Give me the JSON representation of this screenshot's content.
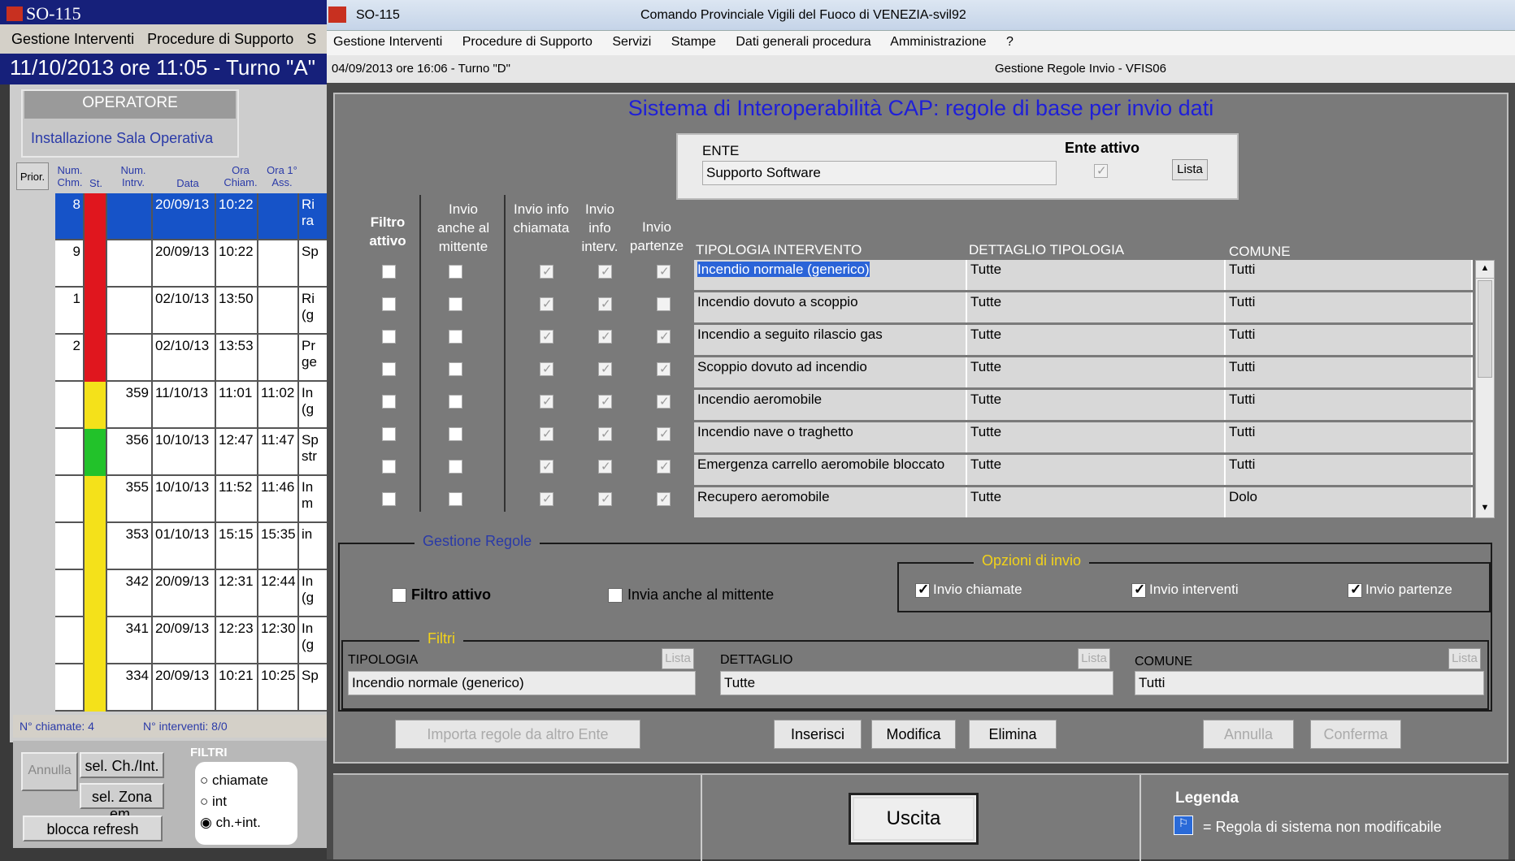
{
  "bg_window": {
    "title": "SO-115",
    "menu": [
      "Gestione Interventi",
      "Procedure di Supporto",
      "S"
    ],
    "datetime": "11/10/2013 ore 11:05 - Turno \"A\"",
    "operator_header": "OPERATORE",
    "operator_sub": "Installazione Sala Operativa",
    "prior_button": "Prior.",
    "columns": [
      "Num. Chm.",
      "St.",
      "Num. Intrv.",
      "Data",
      "Ora Chiam.",
      "Ora 1° Ass."
    ],
    "rows": [
      {
        "num_chm": "8",
        "status": "#e0161e",
        "num_intrv": "",
        "data": "20/09/13",
        "ora_chiam": "10:22",
        "ora_ass": "",
        "desc": "Ri ra",
        "selected": true
      },
      {
        "num_chm": "9",
        "status": "#e0161e",
        "num_intrv": "",
        "data": "20/09/13",
        "ora_chiam": "10:22",
        "ora_ass": "",
        "desc": "Sp"
      },
      {
        "num_chm": "1",
        "status": "#e0161e",
        "num_intrv": "",
        "data": "02/10/13",
        "ora_chiam": "13:50",
        "ora_ass": "",
        "desc": "Ri (g"
      },
      {
        "num_chm": "2",
        "status": "#e0161e",
        "num_intrv": "",
        "data": "02/10/13",
        "ora_chiam": "13:53",
        "ora_ass": "",
        "desc": "Pr ge"
      },
      {
        "num_chm": "",
        "status": "#f4e11a",
        "num_intrv": "359",
        "data": "11/10/13",
        "ora_chiam": "11:01",
        "ora_ass": "11:02",
        "desc": "In (g"
      },
      {
        "num_chm": "",
        "status": "#22c22a",
        "num_intrv": "356",
        "data": "10/10/13",
        "ora_chiam": "12:47",
        "ora_ass": "11:47",
        "desc": "Sp str"
      },
      {
        "num_chm": "",
        "status": "#f4e11a",
        "num_intrv": "355",
        "data": "10/10/13",
        "ora_chiam": "11:52",
        "ora_ass": "11:46",
        "desc": "In m"
      },
      {
        "num_chm": "",
        "status": "#f4e11a",
        "num_intrv": "353",
        "data": "01/10/13",
        "ora_chiam": "15:15",
        "ora_ass": "15:35",
        "desc": "in"
      },
      {
        "num_chm": "",
        "status": "#f4e11a",
        "num_intrv": "342",
        "data": "20/09/13",
        "ora_chiam": "12:31",
        "ora_ass": "12:44",
        "desc": "In (g"
      },
      {
        "num_chm": "",
        "status": "#f4e11a",
        "num_intrv": "341",
        "data": "20/09/13",
        "ora_chiam": "12:23",
        "ora_ass": "12:30",
        "desc": "In (g"
      },
      {
        "num_chm": "",
        "status": "#f4e11a",
        "num_intrv": "334",
        "data": "20/09/13",
        "ora_chiam": "10:21",
        "ora_ass": "10:25",
        "desc": "Sp"
      }
    ],
    "footer_chiamate": "N° chiamate: 4",
    "footer_interventi": "N° interventi: 8/0",
    "btn_annulla": "Annulla",
    "btn_sel_ch": "sel. Ch./Int.",
    "btn_sel_zona": "sel. Zona em.",
    "btn_blocca": "blocca refresh",
    "filtri_label": "FILTRI",
    "radio": [
      "chiamate",
      "int",
      "ch.+int."
    ],
    "radio_selected": 2
  },
  "window": {
    "app": "SO-115",
    "title": "Comando Provinciale Vigili del Fuoco di VENEZIA-svil92",
    "menu": [
      "Gestione Interventi",
      "Procedure di Supporto",
      "Servizi",
      "Stampe",
      "Dati generali procedura",
      "Amministrazione",
      "?"
    ],
    "status_left": "04/09/2013 ore 16:06 - Turno \"D\"",
    "status_center": "Gestione Regole Invio - VFIS06"
  },
  "heading": "Sistema di Interoperabilità CAP: regole di base per invio dati",
  "ente": {
    "label": "ENTE",
    "value": "Supporto Software",
    "attivo_label": "Ente attivo",
    "attivo": true,
    "lista": "Lista"
  },
  "columns": {
    "filtro": "Filtro attivo",
    "mittente": "Invio anche al mittente",
    "chiamata": "Invio info chiamata",
    "interv": "Invio info interv.",
    "partenze": "Invio partenze",
    "tipologia": "TIPOLOGIA INTERVENTO",
    "dettaglio": "DETTAGLIO TIPOLOGIA",
    "comune": "COMUNE"
  },
  "rules": [
    {
      "tipologia": "Incendio normale (generico)",
      "dettaglio": "Tutte",
      "comune": "Tutti",
      "filtro": false,
      "mittente": false,
      "chiamata": true,
      "interv": true,
      "partenze": true
    },
    {
      "tipologia": "Incendio dovuto a scoppio",
      "dettaglio": "Tutte",
      "comune": "Tutti",
      "filtro": false,
      "mittente": false,
      "chiamata": true,
      "interv": true,
      "partenze": false
    },
    {
      "tipologia": "Incendio a seguito rilascio gas",
      "dettaglio": "Tutte",
      "comune": "Tutti",
      "filtro": false,
      "mittente": false,
      "chiamata": true,
      "interv": true,
      "partenze": true
    },
    {
      "tipologia": "Scoppio dovuto ad incendio",
      "dettaglio": "Tutte",
      "comune": "Tutti",
      "filtro": false,
      "mittente": false,
      "chiamata": true,
      "interv": true,
      "partenze": true
    },
    {
      "tipologia": "Incendio aeromobile",
      "dettaglio": "Tutte",
      "comune": "Tutti",
      "filtro": false,
      "mittente": false,
      "chiamata": true,
      "interv": true,
      "partenze": true
    },
    {
      "tipologia": "Incendio nave o traghetto",
      "dettaglio": "Tutte",
      "comune": "Tutti",
      "filtro": false,
      "mittente": false,
      "chiamata": true,
      "interv": true,
      "partenze": true
    },
    {
      "tipologia": "Emergenza carrello aeromobile bloccato",
      "dettaglio": "Tutte",
      "comune": "Tutti",
      "filtro": false,
      "mittente": false,
      "chiamata": true,
      "interv": true,
      "partenze": true
    },
    {
      "tipologia": "Recupero aeromobile",
      "dettaglio": "Tutte",
      "comune": "Dolo",
      "filtro": false,
      "mittente": false,
      "chiamata": true,
      "interv": true,
      "partenze": true
    }
  ],
  "gestione": {
    "legend": "Gestione Regole",
    "filtro_attivo": "Filtro attivo",
    "invia_mittente": "Invia anche al mittente",
    "opzioni_legend": "Opzioni di invio",
    "opt_chiamate": "Invio chiamate",
    "opt_interventi": "Invio interventi",
    "opt_partenze": "Invio partenze",
    "filtri_legend": "Filtri",
    "tipologia_label": "TIPOLOGIA",
    "tipologia_value": "Incendio normale (generico)",
    "dettaglio_label": "DETTAGLIO",
    "dettaglio_value": "Tutte",
    "comune_label": "COMUNE",
    "comune_value": "Tutti",
    "lista": "Lista",
    "btn_importa": "Importa regole da altro Ente",
    "btn_inserisci": "Inserisci",
    "btn_modifica": "Modifica",
    "btn_elimina": "Elimina",
    "btn_annulla": "Annulla",
    "btn_conferma": "Conferma"
  },
  "bottom": {
    "uscita": "Uscita",
    "legenda_title": "Legenda",
    "legenda_text": "= Regola di sistema non modificabile"
  }
}
